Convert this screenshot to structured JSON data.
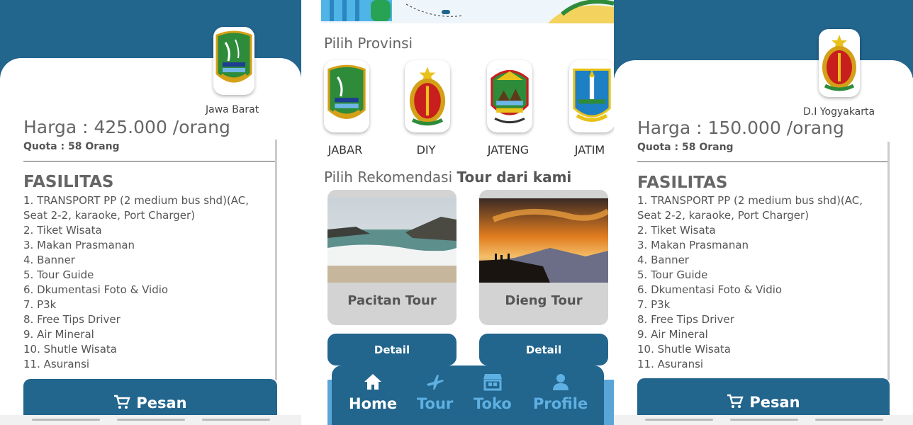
{
  "colors": {
    "primary": "#22658d",
    "nav_idle": "#5fb0e2",
    "card_gray": "#d3d3d3"
  },
  "left": {
    "province_name": "Jawa Barat",
    "price": "Harga : 425.000 /orang",
    "quota": "Quota : 58 Orang",
    "facilities_title": "FASILITAS",
    "facilities": [
      "1. TRANSPORT PP (2 medium bus shd)(AC, Seat 2-2, karaoke, Port Charger)",
      "2. Tiket Wisata",
      "3. Makan Prasmanan",
      "4. Banner",
      "5. Tour Guide",
      "6. Dkumentasi Foto & Vidio",
      "7. P3k",
      "8. Free Tips Driver",
      "9. Air Mineral",
      "10. Shutle Wisata",
      "11. Asuransi"
    ],
    "order_label": "Pesan",
    "cart_icon": "cart-icon"
  },
  "middle": {
    "province_section_title": "Pilih Provinsi",
    "provinces": [
      {
        "label": "JABAR",
        "icon": "jabar-emblem-icon"
      },
      {
        "label": "DIY",
        "icon": "diy-emblem-icon"
      },
      {
        "label": "JATENG",
        "icon": "jateng-emblem-icon"
      },
      {
        "label": "JATIM",
        "icon": "jatim-emblem-icon"
      }
    ],
    "recommend_title_regular": "Pilih Rekomendasi",
    "recommend_title_bold": "Tour dari kami",
    "tours": [
      {
        "name": "Pacitan Tour",
        "detail_label": "Detail"
      },
      {
        "name": "Dieng Tour",
        "detail_label": "Detail"
      }
    ],
    "nav": [
      {
        "label": "Home",
        "icon": "home-icon",
        "active": true
      },
      {
        "label": "Tour",
        "icon": "airplane-icon",
        "active": false
      },
      {
        "label": "Toko",
        "icon": "store-icon",
        "active": false
      },
      {
        "label": "Profile",
        "icon": "person-icon",
        "active": false
      }
    ]
  },
  "right": {
    "province_name": "D.I Yogyakarta",
    "price": "Harga : 150.000 /orang",
    "quota": "Quota : 58 Orang",
    "facilities_title": "FASILITAS",
    "facilities": [
      "1. TRANSPORT PP (2 medium bus shd)(AC, Seat 2-2, karaoke, Port Charger)",
      "2. Tiket Wisata",
      "3. Makan Prasmanan",
      "4. Banner",
      "5. Tour Guide",
      "6. Dkumentasi Foto & Vidio",
      "7. P3k",
      "8. Free Tips Driver",
      "9. Air Mineral",
      "10. Shutle Wisata",
      "11. Asuransi"
    ],
    "order_label": "Pesan",
    "cart_icon": "cart-icon"
  }
}
